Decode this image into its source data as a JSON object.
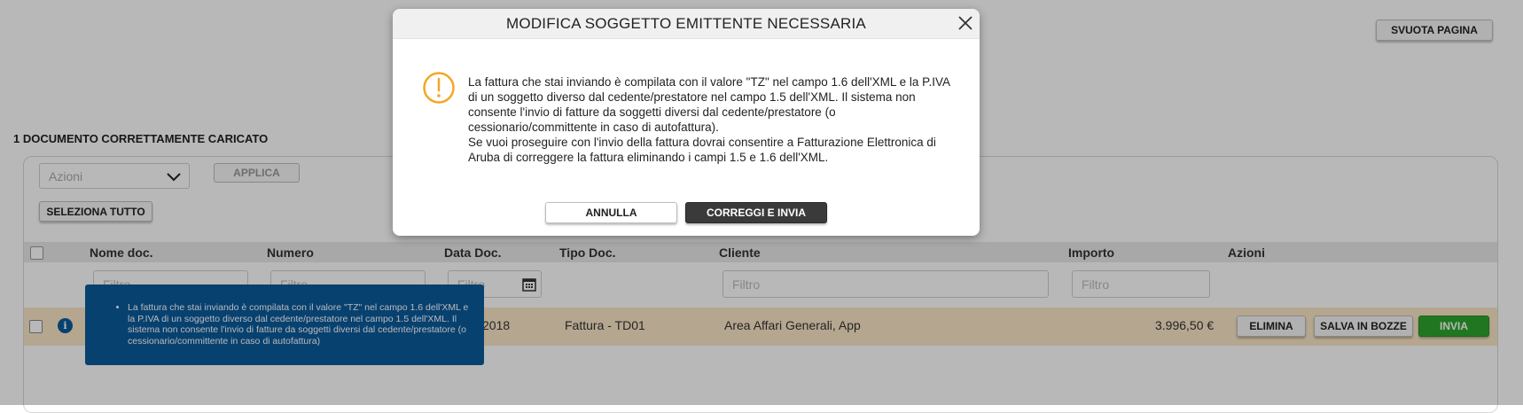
{
  "toolbar": {
    "empty_page_label": "SVUOTA PAGINA"
  },
  "section_title": "1 DOCUMENTO CORRETTAMENTE CARICATO",
  "actions": {
    "select_placeholder": "Azioni",
    "apply_label": "APPLICA",
    "select_all_label": "SELEZIONA TUTTO"
  },
  "table": {
    "columns": [
      "Nome doc.",
      "Numero",
      "Data Doc.",
      "Tipo Doc.",
      "Cliente",
      "Importo",
      "Azioni"
    ],
    "filter_placeholder": "Filtro",
    "row": {
      "date": "2018",
      "type": "Fattura - TD01",
      "client": "Area Affari Generali, App",
      "amount": "3.996,50 €",
      "delete_label": "ELIMINA",
      "save_draft_label": "SALVA IN BOZZE",
      "send_label": "INVIA"
    }
  },
  "tooltip": {
    "text": "La fattura che stai inviando è compilata con il valore \"TZ\" nel campo 1.6 dell'XML e la P.IVA di un soggetto diverso dal cedente/prestatore nel campo 1.5 dell'XML. Il sistema non consente l'invio di fatture da soggetti diversi dal cedente/prestatore (o cessionario/committente in caso di autofattura)"
  },
  "modal": {
    "title": "MODIFICA SOGGETTO EMITTENTE NECESSARIA",
    "paragraph1": "La fattura che stai inviando è compilata con il valore \"TZ\" nel campo 1.6 dell'XML e la P.IVA di un soggetto diverso dal cedente/prestatore nel campo 1.5 dell'XML. Il sistema non consente l'invio di fatture da soggetti diversi dal cedente/prestatore (o cessionario/committente in caso di autofattura).",
    "paragraph2": "Se vuoi proseguire con l'invio della fattura dovrai consentire a Fatturazione Elettronica di Aruba di correggere la fattura eliminando i campi 1.5 e 1.6 dell'XML.",
    "cancel_label": "ANNULLA",
    "confirm_label": "CORREGGI E INVIA"
  },
  "colors": {
    "warning": "#f5a623",
    "tooltip_bg": "#0a5a9c",
    "send_green": "#2fa52f",
    "row_highlight": "#fbe6c6",
    "confirm_dark": "#3a3a3a"
  }
}
